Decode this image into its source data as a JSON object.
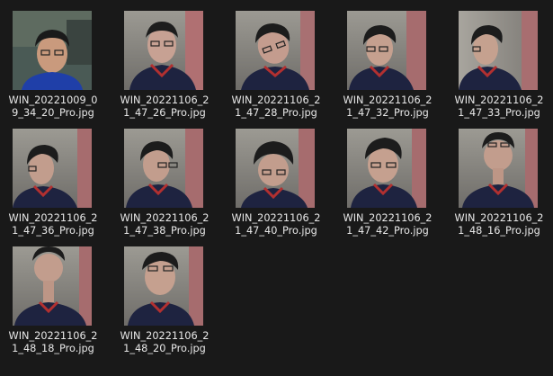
{
  "explorer": {
    "files": [
      {
        "line1": "WIN_20221009_0",
        "line2": "9_34_20_Pro.jpg",
        "icon": "photo-thumbnail-icon"
      },
      {
        "line1": "WIN_20221106_2",
        "line2": "1_47_26_Pro.jpg",
        "icon": "photo-thumbnail-icon"
      },
      {
        "line1": "WIN_20221106_2",
        "line2": "1_47_28_Pro.jpg",
        "icon": "photo-thumbnail-icon"
      },
      {
        "line1": "WIN_20221106_2",
        "line2": "1_47_32_Pro.jpg",
        "icon": "photo-thumbnail-icon"
      },
      {
        "line1": "WIN_20221106_2",
        "line2": "1_47_33_Pro.jpg",
        "icon": "photo-thumbnail-icon"
      },
      {
        "line1": "WIN_20221106_2",
        "line2": "1_47_36_Pro.jpg",
        "icon": "photo-thumbnail-icon"
      },
      {
        "line1": "WIN_20221106_2",
        "line2": "1_47_38_Pro.jpg",
        "icon": "photo-thumbnail-icon"
      },
      {
        "line1": "WIN_20221106_2",
        "line2": "1_47_40_Pro.jpg",
        "icon": "photo-thumbnail-icon"
      },
      {
        "line1": "WIN_20221106_2",
        "line2": "1_47_42_Pro.jpg",
        "icon": "photo-thumbnail-icon"
      },
      {
        "line1": "WIN_20221106_2",
        "line2": "1_48_16_Pro.jpg",
        "icon": "photo-thumbnail-icon"
      },
      {
        "line1": "WIN_20221106_2",
        "line2": "1_48_18_Pro.jpg",
        "icon": "photo-thumbnail-icon"
      },
      {
        "line1": "WIN_20221106_2",
        "line2": "1_48_20_Pro.jpg",
        "icon": "photo-thumbnail-icon"
      }
    ]
  },
  "colors": {
    "background": "#191919",
    "label_text": "#e8e8e8"
  }
}
